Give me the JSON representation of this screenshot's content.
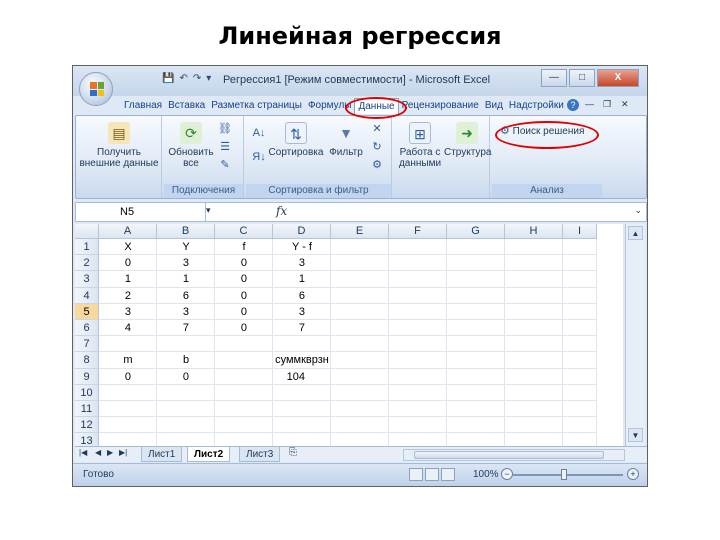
{
  "slide_title": "Линейная регрессия",
  "window": {
    "title": "Регрессия1 [Режим совместимости] - Microsoft Excel",
    "controls": {
      "minimize": "—",
      "maximize": "□",
      "close": "X"
    }
  },
  "ribbon_tabs": [
    "Главная",
    "Вставка",
    "Разметка страницы",
    "Формулы",
    "Данные",
    "Рецензирование",
    "Вид",
    "Надстройки"
  ],
  "active_tab": "Данные",
  "ribbon": {
    "get_external": "Получить внешние данные",
    "refresh_all": "Обновить все",
    "connections_group": "Подключения",
    "sort": "Сортировка",
    "filter": "Фильтр",
    "sort_filter_group": "Сортировка и фильтр",
    "data_tools": "Работа с данными",
    "outline": "Структура",
    "solver": "Поиск решения",
    "analysis_group": "Анализ"
  },
  "formula_bar": {
    "name_box": "N5",
    "fx": "fx",
    "value": ""
  },
  "columns": [
    "A",
    "B",
    "C",
    "D",
    "E",
    "F",
    "G",
    "H",
    "I"
  ],
  "rows": [
    {
      "n": "1",
      "cells": [
        "X",
        "Y",
        "f",
        "Y - f",
        "",
        "",
        "",
        "",
        ""
      ]
    },
    {
      "n": "2",
      "cells": [
        "0",
        "3",
        "0",
        "3",
        "",
        "",
        "",
        "",
        ""
      ]
    },
    {
      "n": "3",
      "cells": [
        "1",
        "1",
        "0",
        "1",
        "",
        "",
        "",
        "",
        ""
      ]
    },
    {
      "n": "4",
      "cells": [
        "2",
        "6",
        "0",
        "6",
        "",
        "",
        "",
        "",
        ""
      ]
    },
    {
      "n": "5",
      "cells": [
        "3",
        "3",
        "0",
        "3",
        "",
        "",
        "",
        "",
        ""
      ]
    },
    {
      "n": "6",
      "cells": [
        "4",
        "7",
        "0",
        "7",
        "",
        "",
        "",
        "",
        ""
      ]
    },
    {
      "n": "7",
      "cells": [
        "",
        "",
        "",
        "",
        "",
        "",
        "",
        "",
        ""
      ]
    },
    {
      "n": "8",
      "cells": [
        "m",
        "b",
        "",
        "суммкврзн",
        "",
        "",
        "",
        "",
        ""
      ]
    },
    {
      "n": "9",
      "cells": [
        "0",
        "0",
        "",
        "104",
        "",
        "",
        "",
        "",
        ""
      ]
    },
    {
      "n": "10",
      "cells": [
        "",
        "",
        "",
        "",
        "",
        "",
        "",
        "",
        ""
      ]
    },
    {
      "n": "11",
      "cells": [
        "",
        "",
        "",
        "",
        "",
        "",
        "",
        "",
        ""
      ]
    },
    {
      "n": "12",
      "cells": [
        "",
        "",
        "",
        "",
        "",
        "",
        "",
        "",
        ""
      ]
    },
    {
      "n": "13",
      "cells": [
        "",
        "",
        "",
        "",
        "",
        "",
        "",
        "",
        ""
      ]
    }
  ],
  "selected_row": "5",
  "sheets": [
    "Лист1",
    "Лист2",
    "Лист3"
  ],
  "active_sheet": "Лист2",
  "status": {
    "text": "Готово",
    "zoom": "100%"
  },
  "colors": {
    "highlight_oval": "#e00000",
    "ribbon_text": "#1e395b",
    "selected_row_header": "#f9d99b"
  }
}
